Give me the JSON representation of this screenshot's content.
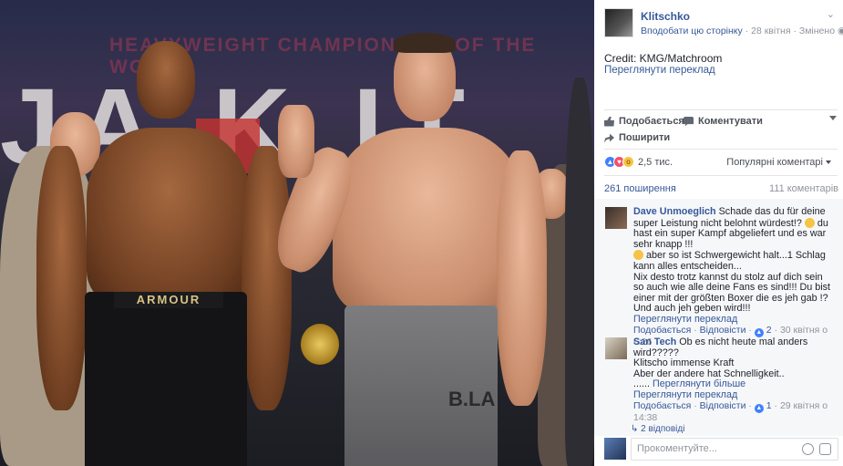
{
  "post": {
    "page_name": "Klitschko",
    "follow_link": "Вподобати цю сторінку",
    "date": "28 квітня",
    "edited": "Змінено",
    "caption": "Credit: KMG/Matchroom",
    "translate_link": "Переглянути переклад",
    "photo_banner": "HEAVYWEIGHT CHAMPIONSHIP OF THE WORLD",
    "photo_big": "JA   K  IT",
    "photo_trunks_left": "ARMOUR",
    "photo_trunks_right": "B.LA"
  },
  "actions": {
    "like": "Подобається",
    "comment": "Коментувати",
    "share": "Поширити"
  },
  "stats": {
    "reaction_count": "2,5 тис.",
    "sort_label": "Популярні коментарі",
    "shares": "261 поширення",
    "comments": "111 коментарів"
  },
  "comments": [
    {
      "author": "Dave Unmoeglich",
      "text1": "Schade das du für deine super Leistung nicht belohnt würdest!?",
      "text2": "du hast ein super Kampf abgeliefert und es war sehr knapp !!!",
      "text3": "aber so ist Schwergewicht halt...1 Schlag kann alles entscheiden...",
      "text4": "Nix desto trotz kannst du stolz auf dich sein so auch wie alle deine Fans es sind!!! Du bist einer mit der größten Boxer die es jeh gab !? Und auch jeh geben wird!!!",
      "translate": "Переглянути переклад",
      "like": "Подобається",
      "reply": "Відповісти",
      "likes": "2",
      "time": "30 квітня о 6:26"
    },
    {
      "author": "San Tech",
      "text1": "Ob es nicht heute mal anders wird?????",
      "text2": "Klitscho immense Kraft",
      "text3": "Aber der andere hat Schnelligkeit..",
      "more": "Переглянути більше",
      "dots": "......",
      "translate": "Переглянути переклад",
      "like": "Подобається",
      "reply": "Відповісти",
      "likes": "1",
      "time": "29 квітня о 14:38"
    }
  ],
  "replies": "2 відповіді",
  "composer": {
    "placeholder": "Прокоментуйте..."
  },
  "colors": {
    "link": "#365899",
    "muted": "#90949c",
    "like_blue": "#4080ff"
  }
}
